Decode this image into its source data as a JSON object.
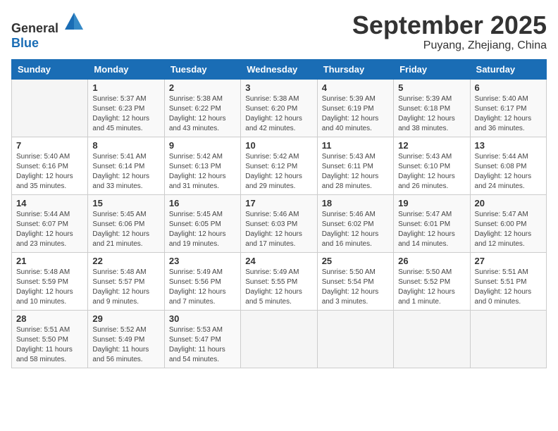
{
  "header": {
    "logo_general": "General",
    "logo_blue": "Blue",
    "month": "September 2025",
    "location": "Puyang, Zhejiang, China"
  },
  "weekdays": [
    "Sunday",
    "Monday",
    "Tuesday",
    "Wednesday",
    "Thursday",
    "Friday",
    "Saturday"
  ],
  "weeks": [
    [
      {
        "day": "",
        "info": ""
      },
      {
        "day": "1",
        "info": "Sunrise: 5:37 AM\nSunset: 6:23 PM\nDaylight: 12 hours\nand 45 minutes."
      },
      {
        "day": "2",
        "info": "Sunrise: 5:38 AM\nSunset: 6:22 PM\nDaylight: 12 hours\nand 43 minutes."
      },
      {
        "day": "3",
        "info": "Sunrise: 5:38 AM\nSunset: 6:20 PM\nDaylight: 12 hours\nand 42 minutes."
      },
      {
        "day": "4",
        "info": "Sunrise: 5:39 AM\nSunset: 6:19 PM\nDaylight: 12 hours\nand 40 minutes."
      },
      {
        "day": "5",
        "info": "Sunrise: 5:39 AM\nSunset: 6:18 PM\nDaylight: 12 hours\nand 38 minutes."
      },
      {
        "day": "6",
        "info": "Sunrise: 5:40 AM\nSunset: 6:17 PM\nDaylight: 12 hours\nand 36 minutes."
      }
    ],
    [
      {
        "day": "7",
        "info": "Sunrise: 5:40 AM\nSunset: 6:16 PM\nDaylight: 12 hours\nand 35 minutes."
      },
      {
        "day": "8",
        "info": "Sunrise: 5:41 AM\nSunset: 6:14 PM\nDaylight: 12 hours\nand 33 minutes."
      },
      {
        "day": "9",
        "info": "Sunrise: 5:42 AM\nSunset: 6:13 PM\nDaylight: 12 hours\nand 31 minutes."
      },
      {
        "day": "10",
        "info": "Sunrise: 5:42 AM\nSunset: 6:12 PM\nDaylight: 12 hours\nand 29 minutes."
      },
      {
        "day": "11",
        "info": "Sunrise: 5:43 AM\nSunset: 6:11 PM\nDaylight: 12 hours\nand 28 minutes."
      },
      {
        "day": "12",
        "info": "Sunrise: 5:43 AM\nSunset: 6:10 PM\nDaylight: 12 hours\nand 26 minutes."
      },
      {
        "day": "13",
        "info": "Sunrise: 5:44 AM\nSunset: 6:08 PM\nDaylight: 12 hours\nand 24 minutes."
      }
    ],
    [
      {
        "day": "14",
        "info": "Sunrise: 5:44 AM\nSunset: 6:07 PM\nDaylight: 12 hours\nand 23 minutes."
      },
      {
        "day": "15",
        "info": "Sunrise: 5:45 AM\nSunset: 6:06 PM\nDaylight: 12 hours\nand 21 minutes."
      },
      {
        "day": "16",
        "info": "Sunrise: 5:45 AM\nSunset: 6:05 PM\nDaylight: 12 hours\nand 19 minutes."
      },
      {
        "day": "17",
        "info": "Sunrise: 5:46 AM\nSunset: 6:03 PM\nDaylight: 12 hours\nand 17 minutes."
      },
      {
        "day": "18",
        "info": "Sunrise: 5:46 AM\nSunset: 6:02 PM\nDaylight: 12 hours\nand 16 minutes."
      },
      {
        "day": "19",
        "info": "Sunrise: 5:47 AM\nSunset: 6:01 PM\nDaylight: 12 hours\nand 14 minutes."
      },
      {
        "day": "20",
        "info": "Sunrise: 5:47 AM\nSunset: 6:00 PM\nDaylight: 12 hours\nand 12 minutes."
      }
    ],
    [
      {
        "day": "21",
        "info": "Sunrise: 5:48 AM\nSunset: 5:59 PM\nDaylight: 12 hours\nand 10 minutes."
      },
      {
        "day": "22",
        "info": "Sunrise: 5:48 AM\nSunset: 5:57 PM\nDaylight: 12 hours\nand 9 minutes."
      },
      {
        "day": "23",
        "info": "Sunrise: 5:49 AM\nSunset: 5:56 PM\nDaylight: 12 hours\nand 7 minutes."
      },
      {
        "day": "24",
        "info": "Sunrise: 5:49 AM\nSunset: 5:55 PM\nDaylight: 12 hours\nand 5 minutes."
      },
      {
        "day": "25",
        "info": "Sunrise: 5:50 AM\nSunset: 5:54 PM\nDaylight: 12 hours\nand 3 minutes."
      },
      {
        "day": "26",
        "info": "Sunrise: 5:50 AM\nSunset: 5:52 PM\nDaylight: 12 hours\nand 1 minute."
      },
      {
        "day": "27",
        "info": "Sunrise: 5:51 AM\nSunset: 5:51 PM\nDaylight: 12 hours\nand 0 minutes."
      }
    ],
    [
      {
        "day": "28",
        "info": "Sunrise: 5:51 AM\nSunset: 5:50 PM\nDaylight: 11 hours\nand 58 minutes."
      },
      {
        "day": "29",
        "info": "Sunrise: 5:52 AM\nSunset: 5:49 PM\nDaylight: 11 hours\nand 56 minutes."
      },
      {
        "day": "30",
        "info": "Sunrise: 5:53 AM\nSunset: 5:47 PM\nDaylight: 11 hours\nand 54 minutes."
      },
      {
        "day": "",
        "info": ""
      },
      {
        "day": "",
        "info": ""
      },
      {
        "day": "",
        "info": ""
      },
      {
        "day": "",
        "info": ""
      }
    ]
  ]
}
